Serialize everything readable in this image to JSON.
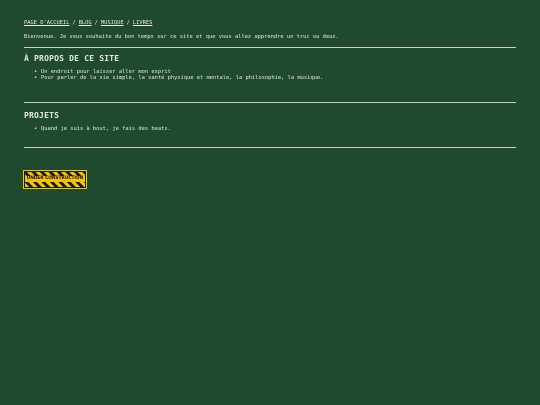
{
  "nav": {
    "items": [
      {
        "label": "PAGE D'ACCUEIL"
      },
      {
        "label": "BLOG"
      },
      {
        "label": "MUSIQUE"
      },
      {
        "label": "LIVRES"
      }
    ],
    "separator": "/"
  },
  "intro": {
    "text": "Bienvenue. Je vous souhaite du bon temps sur ce site et que vous allez apprendre un truc ou deux."
  },
  "about": {
    "title": "À PROPOS DE CE SITE",
    "items": [
      "Un endroit pour laisser aller mon esprit",
      "Pour parler de la vie simple, la santé physique et mentale, la philosophie, la musique."
    ]
  },
  "projects": {
    "title": "PROJETS",
    "items": [
      "Quand je suis à bout, je fais des beats."
    ]
  },
  "badge": {
    "label": "UNDER CONSTRUCTION"
  },
  "colors": {
    "background": "#1f4a2e",
    "text": "#e8ecdf",
    "rule": "#c9cfc4",
    "badge_yellow": "#f2c400"
  }
}
